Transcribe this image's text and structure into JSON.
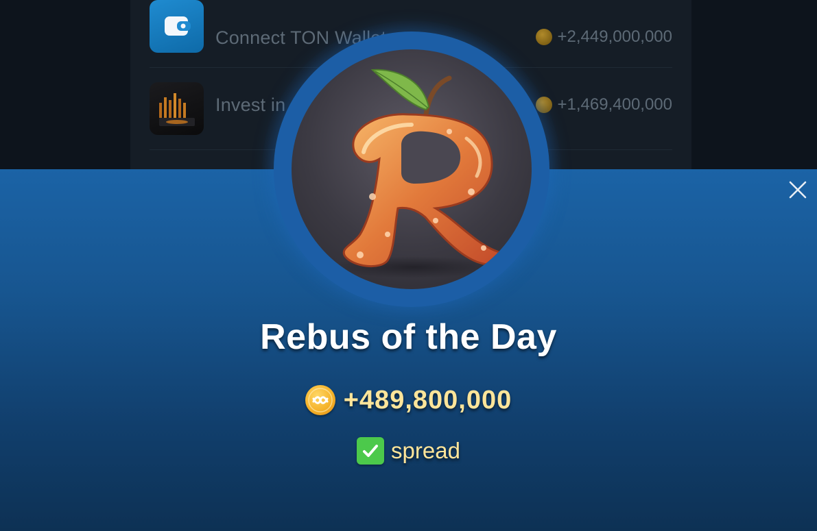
{
  "tasks": [
    {
      "icon": "wallet-icon",
      "label": "Connect TON Wallet",
      "reward": "+2,449,000,000"
    },
    {
      "icon": "chart-icon",
      "label": "Invest in 6",
      "reward": "+1,469,400,000"
    }
  ],
  "modal": {
    "title": "Rebus of the Day",
    "reward": "+489,800,000",
    "answer_prefix": "✅",
    "answer": "spread",
    "close_icon": "close-icon",
    "badge_icon": "apple-r-icon",
    "coin_icon": "coin-icon"
  },
  "colors": {
    "sheet_top": "#1b63a6",
    "sheet_bottom": "#0d3154",
    "reward_text": "#ffe59a",
    "check": "#4cc94b"
  }
}
